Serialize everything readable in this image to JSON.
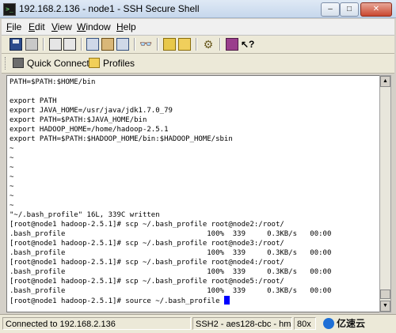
{
  "window": {
    "title": "192.168.2.136 - node1 - SSH Secure Shell",
    "buttons": {
      "minimize": "–",
      "maximize": "□",
      "close": "✕"
    }
  },
  "menu": [
    "File",
    "Edit",
    "View",
    "Window",
    "Help"
  ],
  "quickbar": {
    "connect": "Quick Connect",
    "profiles": "Profiles"
  },
  "terminal": {
    "lines": [
      "PATH=$PATH:$HOME/bin",
      "",
      "export PATH",
      "export JAVA_HOME=/usr/java/jdk1.7.0_79",
      "export PATH=$PATH:$JAVA_HOME/bin",
      "export HADOOP_HOME=/home/hadoop-2.5.1",
      "export PATH=$PATH:$HADOOP_HOME/bin:$HADOOP_HOME/sbin",
      "~",
      "~",
      "~",
      "~",
      "~",
      "~",
      "~",
      "\"~/.bash_profile\" 16L, 339C written",
      "[root@node1 hadoop-2.5.1]# scp ~/.bash_profile root@node2:/root/",
      ".bash_profile                                 100%  339     0.3KB/s   00:00",
      "[root@node1 hadoop-2.5.1]# scp ~/.bash_profile root@node3:/root/",
      ".bash_profile                                 100%  339     0.3KB/s   00:00",
      "[root@node1 hadoop-2.5.1]# scp ~/.bash_profile root@node4:/root/",
      ".bash_profile                                 100%  339     0.3KB/s   00:00",
      "[root@node1 hadoop-2.5.1]# scp ~/.bash_profile root@node5:/root/",
      ".bash_profile                                 100%  339     0.3KB/s   00:00"
    ],
    "prompt_line": "[root@node1 hadoop-2.5.1]# source ~/.bash_profile "
  },
  "status": {
    "connection": "Connected to 192.168.2.136",
    "cipher": "SSH2 - aes128-cbc - hmac-md5",
    "size": "80x"
  },
  "watermark": "亿速云",
  "colors": {
    "cursor": "#0000ff",
    "terminal_bg": "#ffffff"
  }
}
